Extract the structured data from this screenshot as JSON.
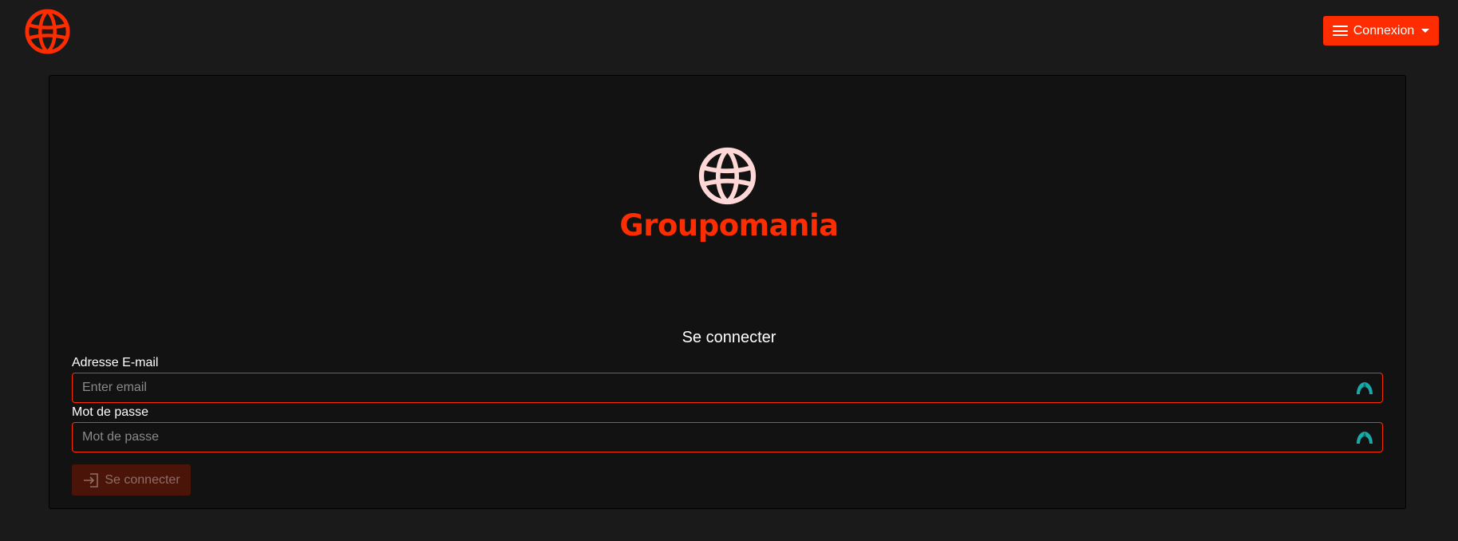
{
  "navbar": {
    "logo_icon": "globe-icon",
    "menu_button": {
      "label": "Connexion",
      "icons": [
        "hamburger-icon",
        "caret-down-icon"
      ]
    }
  },
  "brand": {
    "icon": "globe-icon",
    "name": "Groupomania"
  },
  "login_form": {
    "title": "Se connecter",
    "email": {
      "label": "Adresse E-mail",
      "placeholder": "Enter email",
      "value": ""
    },
    "password": {
      "label": "Mot de passe",
      "placeholder": "Mot de passe",
      "value": ""
    },
    "submit": {
      "label": "Se connecter",
      "icon": "login-icon",
      "disabled": true
    },
    "autofill_icon": "password-manager-icon"
  },
  "colors": {
    "page_background": "#1a1a1a",
    "card_background": "#121212",
    "brand_accent": "#fd2d01",
    "brand_globe": "#ffd7d7",
    "text": "#ffffff",
    "placeholder": "#8a8a8a",
    "autofill_icon": "#1ba8a8",
    "disabled_button": "#4a1508"
  }
}
